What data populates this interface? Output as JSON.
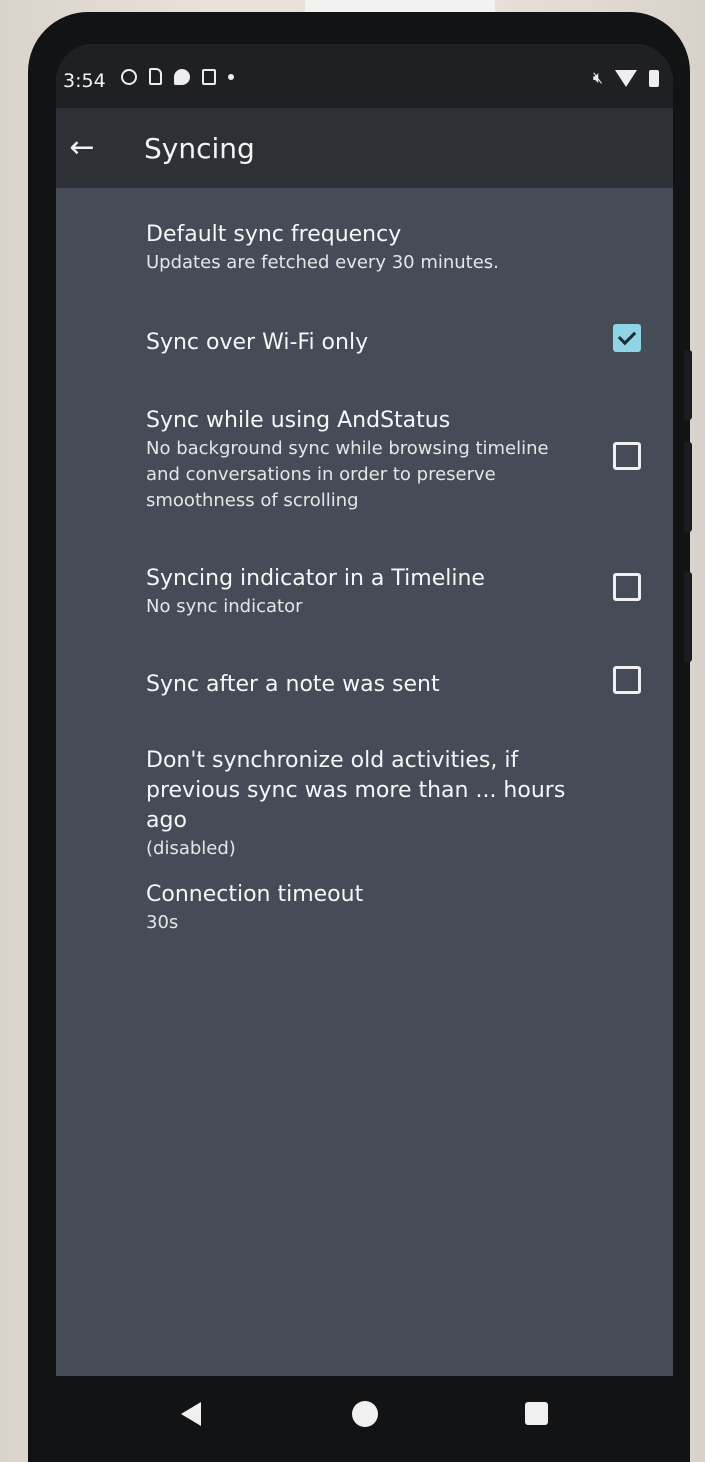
{
  "status_bar": {
    "time": "3:54",
    "icons": [
      "mute-icon",
      "wifi-icon",
      "battery-icon"
    ]
  },
  "app_bar": {
    "back_icon": "←",
    "title": "Syncing"
  },
  "preferences": [
    {
      "title": "Default sync frequency",
      "summary": "Updates are fetched every 30 minutes.",
      "checkbox": null
    },
    {
      "title": "Sync over Wi-Fi only",
      "summary": "",
      "checkbox": true
    },
    {
      "title": "Sync while using AndStatus",
      "summary": "No background sync while browsing timeline and conversations in order to preserve smoothness of scrolling",
      "checkbox": false
    },
    {
      "title": "Syncing indicator in a Timeline",
      "summary": "No sync indicator",
      "checkbox": false
    },
    {
      "title": "Sync after a note was sent",
      "summary": "",
      "checkbox": false
    },
    {
      "title": "Don't synchronize old activities, if previous sync was more than ... hours ago",
      "summary": "(disabled)",
      "checkbox": null
    },
    {
      "title": "Connection timeout",
      "summary": "30s",
      "checkbox": null
    }
  ],
  "colors": {
    "screen_bg": "#454b57",
    "appbar_bg": "#2d3036",
    "accent_checkbox": "#8fd3e6"
  }
}
